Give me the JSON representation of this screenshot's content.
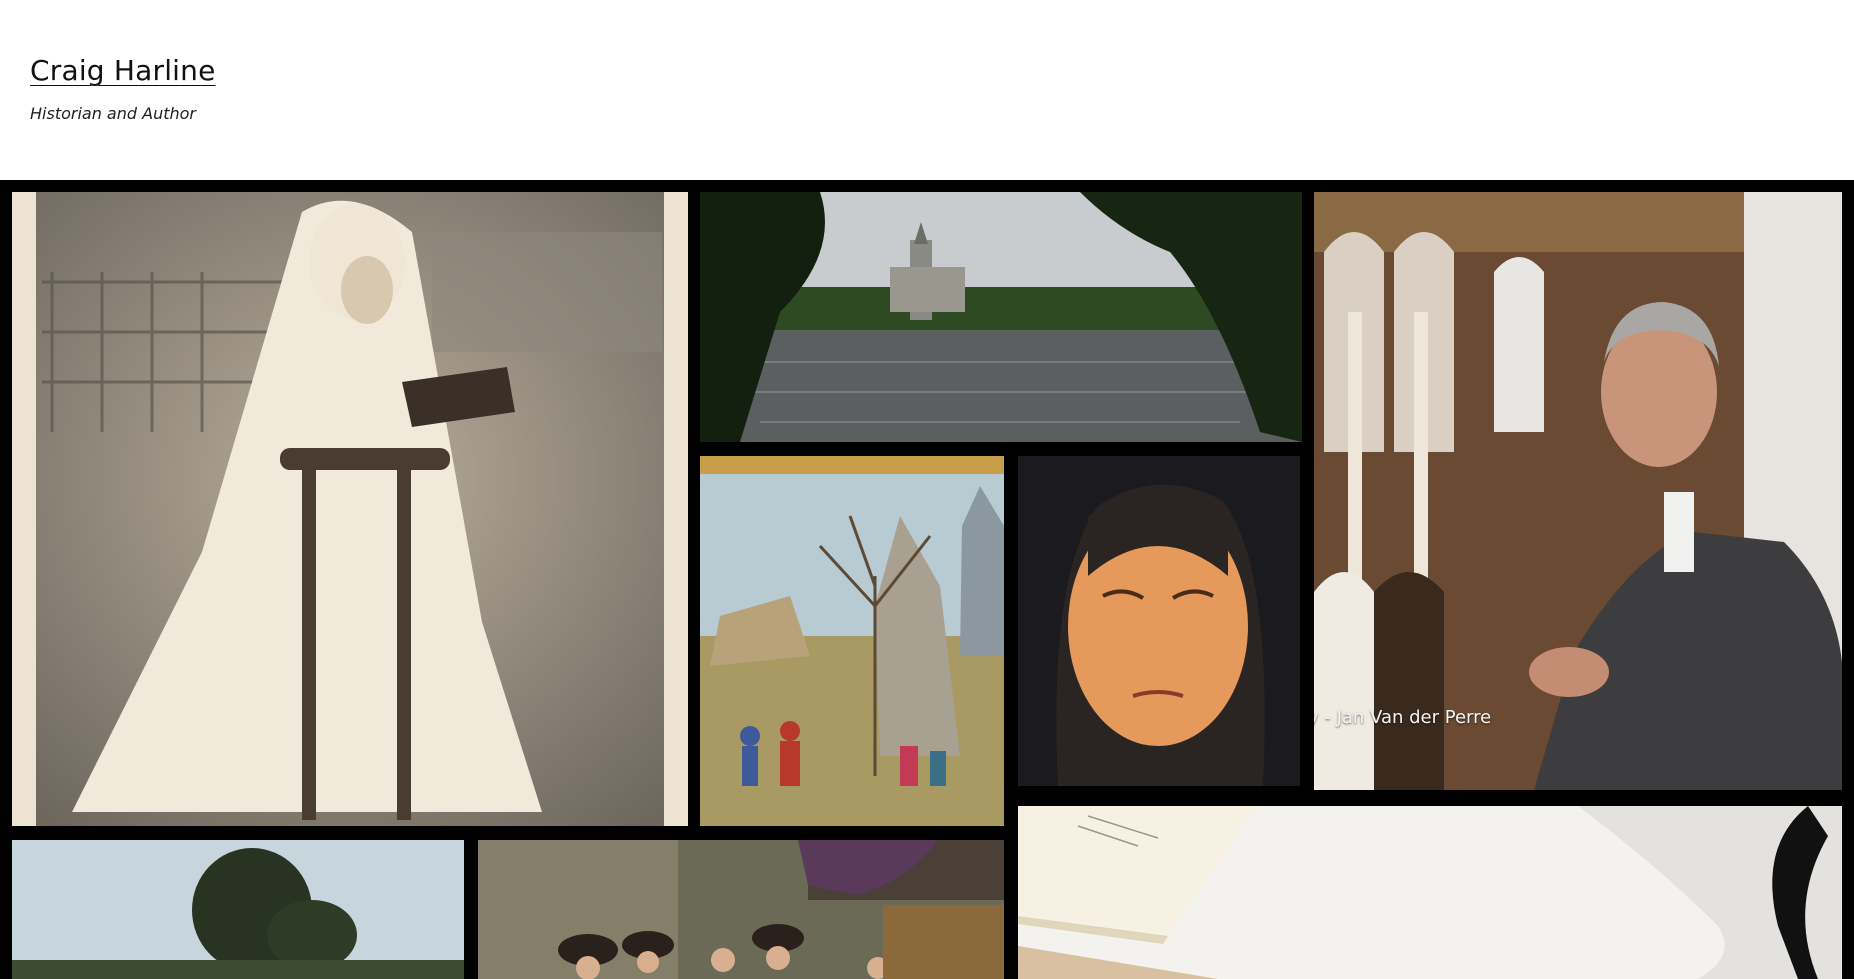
{
  "site": {
    "title": "Craig Harline",
    "tagline": "Historian and Author"
  },
  "gallery": {
    "tiles": [
      {
        "id": "communion-girl",
        "alt": "vintage photo of girl in white veil"
      },
      {
        "id": "abbey-lake",
        "alt": "abbey across a lake"
      },
      {
        "id": "village-miniature",
        "alt": "illuminated village scene"
      },
      {
        "id": "veiled-woman",
        "alt": "portrait of veiled woman"
      },
      {
        "id": "author-portrait",
        "alt": "author in church",
        "caption": "y - Jan Van der Perre"
      },
      {
        "id": "field-trees",
        "alt": "trees over field"
      },
      {
        "id": "baroque-painting",
        "alt": "crowd in baroque painting"
      },
      {
        "id": "notebook-pencil",
        "alt": "notebook and pencil"
      }
    ]
  },
  "colors": {
    "background": "#ffffff",
    "gallery_background": "#000000",
    "text": "#111111"
  }
}
